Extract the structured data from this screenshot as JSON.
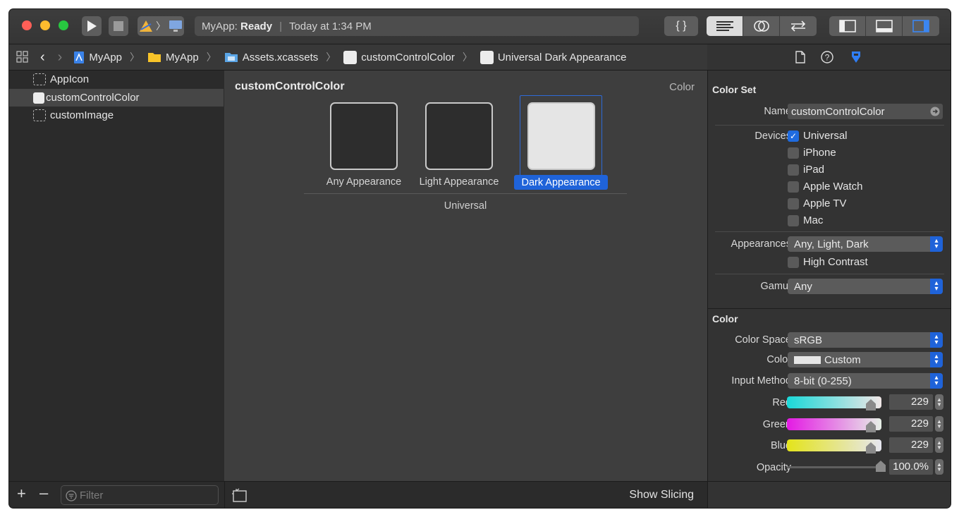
{
  "toolbar": {
    "status_app": "MyApp:",
    "status_state": "Ready",
    "status_time": "Today at 1:34 PM",
    "braces": "{ }"
  },
  "jumpbar": {
    "crumbs": [
      "MyApp",
      "MyApp",
      "Assets.xcassets",
      "customControlColor",
      "Universal Dark Appearance"
    ]
  },
  "navigator": {
    "items": [
      {
        "label": "AppIcon"
      },
      {
        "label": "customControlColor"
      },
      {
        "label": "customImage"
      }
    ],
    "filter_placeholder": "Filter"
  },
  "editor": {
    "title": "customControlColor",
    "type": "Color",
    "wells": [
      {
        "label": "Any Appearance",
        "color": "#2d2d2d"
      },
      {
        "label": "Light Appearance",
        "color": "#2d2d2d"
      },
      {
        "label": "Dark Appearance",
        "color": "#e5e5e5"
      }
    ],
    "group": "Universal",
    "show_slicing": "Show Slicing"
  },
  "inspector": {
    "color_set_title": "Color Set",
    "name_label": "Name",
    "name_value": "customControlColor",
    "devices_label": "Devices",
    "devices": [
      {
        "label": "Universal",
        "checked": true
      },
      {
        "label": "iPhone",
        "checked": false
      },
      {
        "label": "iPad",
        "checked": false
      },
      {
        "label": "Apple Watch",
        "checked": false
      },
      {
        "label": "Apple TV",
        "checked": false
      },
      {
        "label": "Mac",
        "checked": false
      }
    ],
    "appearances_label": "Appearances",
    "appearances_value": "Any, Light, Dark",
    "high_contrast": "High Contrast",
    "gamut_label": "Gamut",
    "gamut_value": "Any",
    "color_title": "Color",
    "color_space_label": "Color Space",
    "color_space_value": "sRGB",
    "color_label": "Color",
    "color_value": "Custom",
    "input_method_label": "Input Method",
    "input_method_value": "8-bit (0-255)",
    "red_label": "Red",
    "red_value": "229",
    "green_label": "Green",
    "green_value": "229",
    "blue_label": "Blue",
    "blue_value": "229",
    "opacity_label": "Opacity",
    "opacity_value": "100.0%"
  },
  "colors": {
    "accent": "#1f63d9",
    "swatch": "#e5e5e5"
  }
}
